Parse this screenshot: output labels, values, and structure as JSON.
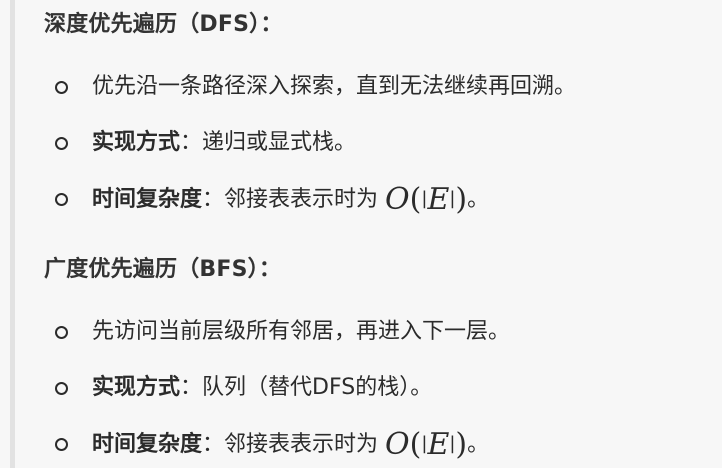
{
  "sections": [
    {
      "heading": "深度优先遍历（DFS）：",
      "items": [
        {
          "label": "",
          "text": "优先沿一条路径深入探索，直到无法继续再回溯。"
        },
        {
          "label": "实现方式",
          "sep": "：",
          "text": "递归或显式栈。"
        },
        {
          "label": "时间复杂度",
          "sep": "：",
          "text": "邻接表表示时为 ",
          "math": {
            "func": "O",
            "open": "(",
            "bar_l": "|",
            "var": "E",
            "bar_r": "|",
            "close": ")"
          },
          "tail": "。"
        }
      ]
    },
    {
      "heading": "广度优先遍历（BFS）：",
      "items": [
        {
          "label": "",
          "text": "先访问当前层级所有邻居，再进入下一层。"
        },
        {
          "label": "实现方式",
          "sep": "：",
          "text": "队列（替代DFS的栈）。"
        },
        {
          "label": "时间复杂度",
          "sep": "：",
          "text": "邻接表表示时为 ",
          "math": {
            "func": "O",
            "open": "(",
            "bar_l": "|",
            "var": "E",
            "bar_r": "|",
            "close": ")"
          },
          "tail": "。"
        }
      ]
    }
  ]
}
